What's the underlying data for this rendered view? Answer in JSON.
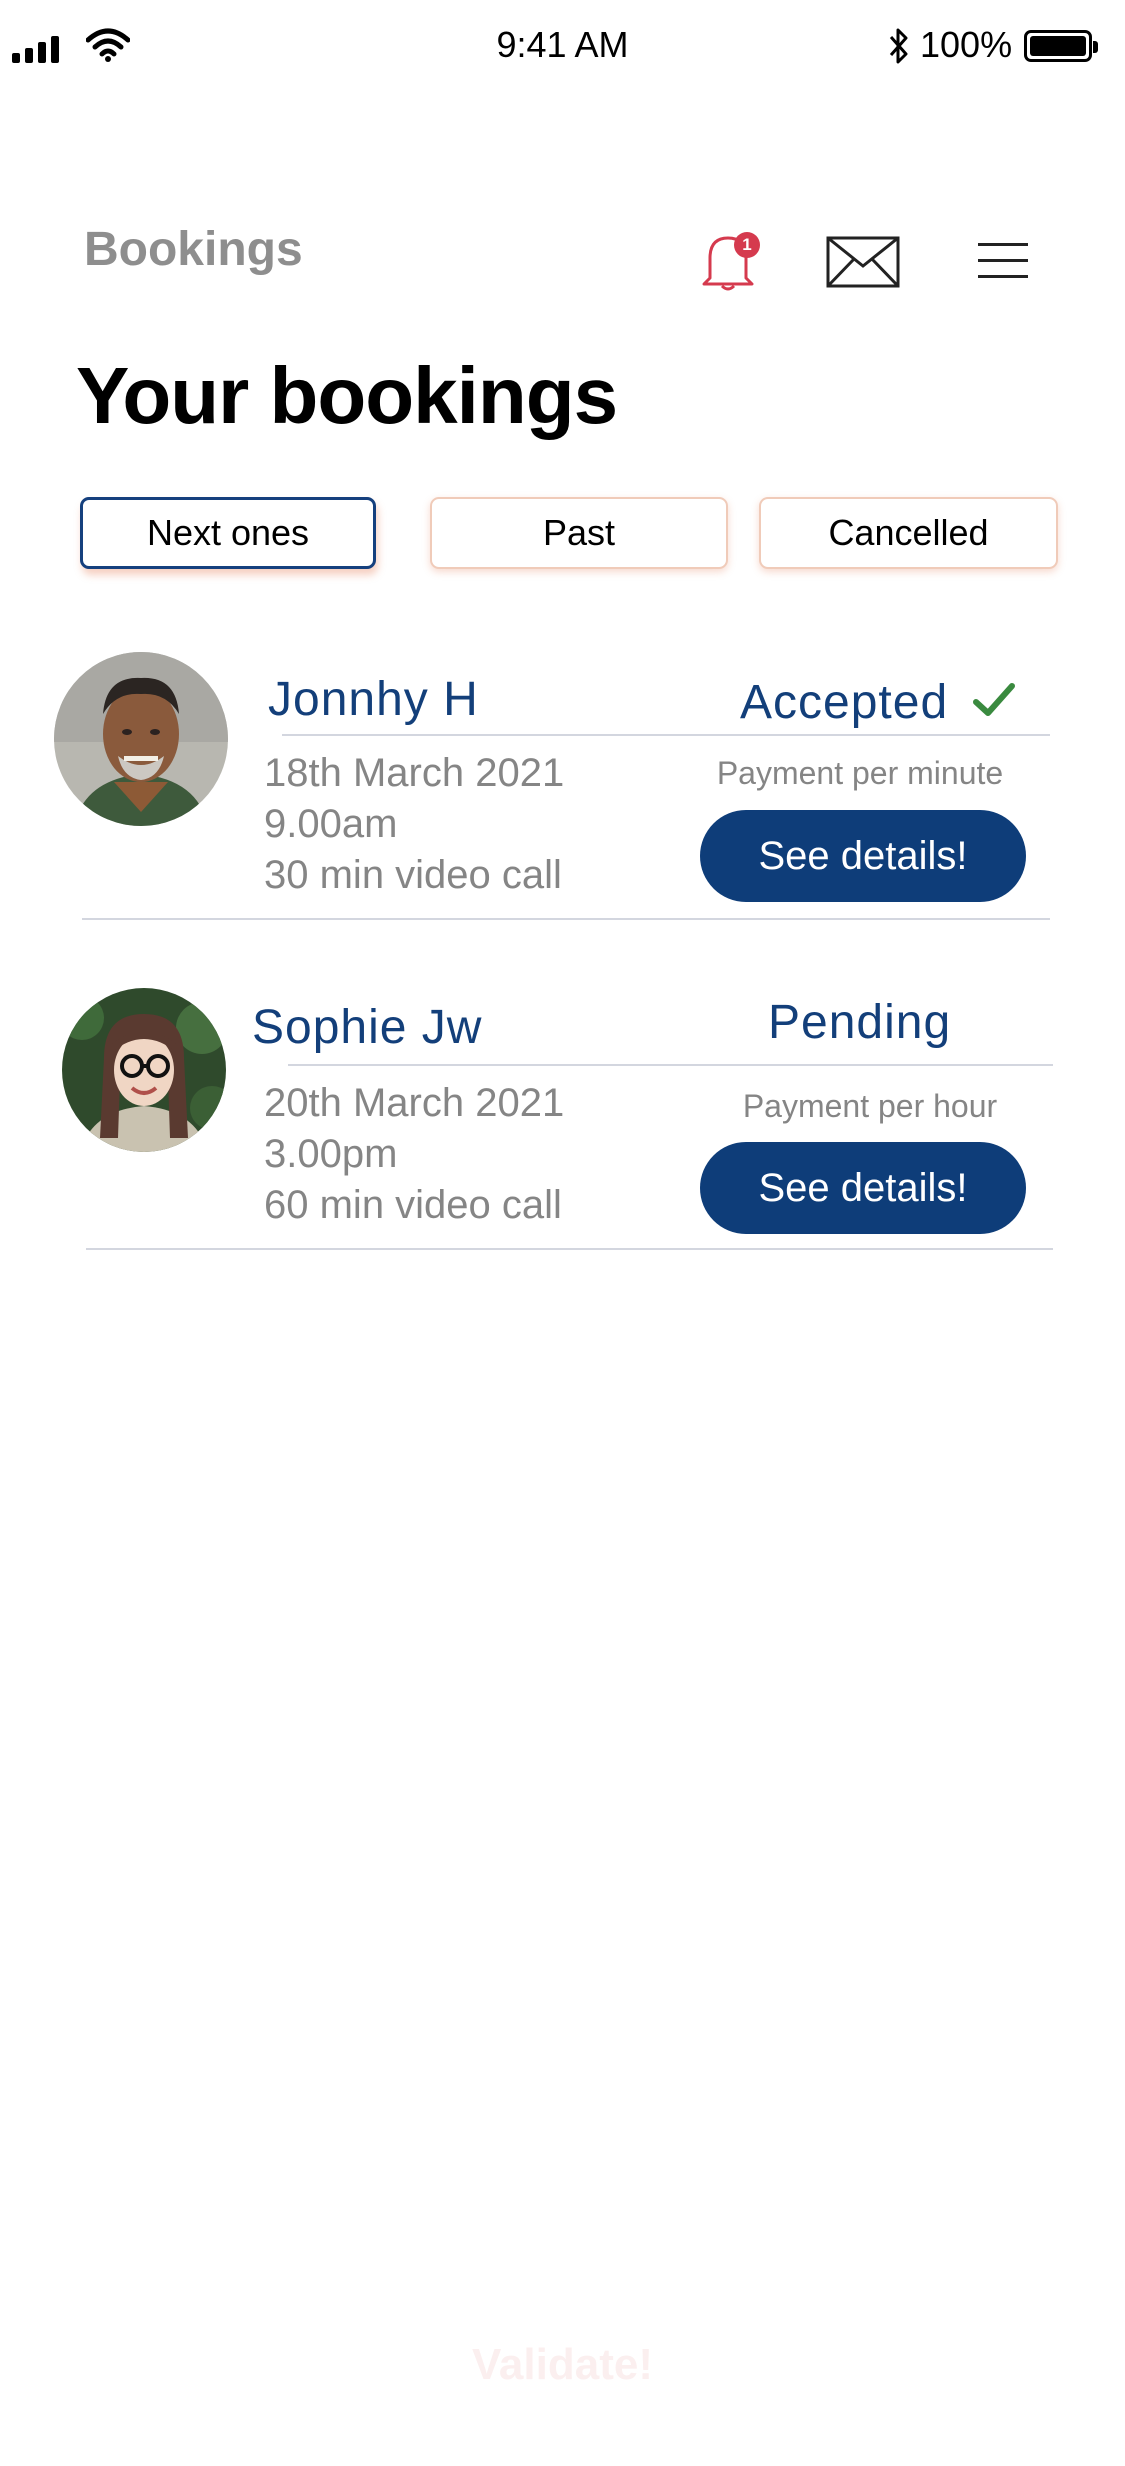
{
  "status_bar": {
    "time": "9:41 AM",
    "battery": "100%",
    "icons": [
      "signal-icon",
      "wifi-icon",
      "bluetooth-icon",
      "battery-icon"
    ]
  },
  "header": {
    "title": "Bookings",
    "notification_count": "1",
    "icons": [
      "bell-icon",
      "mail-icon",
      "menu-icon"
    ]
  },
  "page_title": "Your bookings",
  "tabs": [
    {
      "label": "Next ones",
      "active": true
    },
    {
      "label": "Past",
      "active": false
    },
    {
      "label": "Cancelled",
      "active": false
    }
  ],
  "bookings": [
    {
      "name": "Jonnhy H",
      "status": "Accepted",
      "status_icon": "checkmark-icon",
      "date": "18th March 2021",
      "time": "9.00am",
      "duration": "30 min video call",
      "payment": "Payment per minute",
      "button": "See details!"
    },
    {
      "name": "Sophie Jw",
      "status": "Pending",
      "date": "20th March 2021",
      "time": "3.00pm",
      "duration": "60 min video call",
      "payment": "Payment per hour",
      "button": "See details!"
    }
  ],
  "footer": {
    "validate_label": "Validate!"
  },
  "colors": {
    "brand_blue": "#0e3d79",
    "notification_red": "#d53a4e",
    "accepted_green": "#3a8a3f",
    "muted_gray": "#858585"
  }
}
